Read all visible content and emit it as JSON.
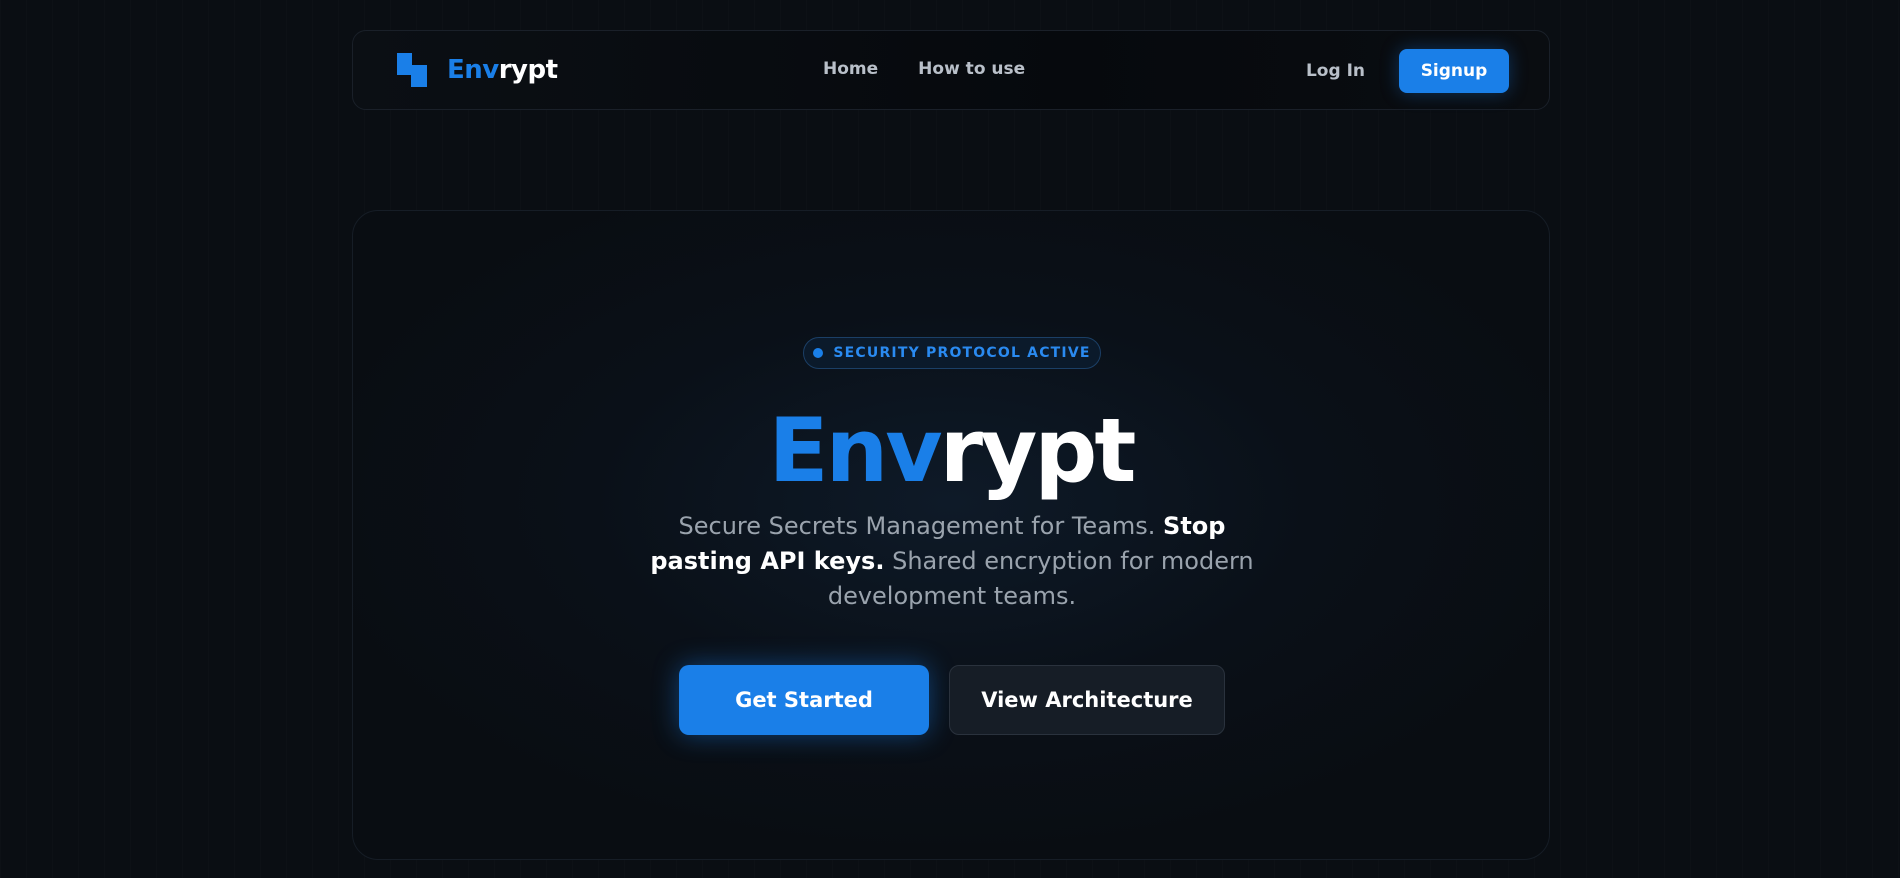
{
  "navbar": {
    "brand": {
      "part1": "Env",
      "part2": "rypt"
    },
    "links": [
      {
        "label": "Home"
      },
      {
        "label": "How to use"
      }
    ],
    "login_label": "Log In",
    "signup_label": "Signup"
  },
  "hero": {
    "badge": "SECURITY PROTOCOL ACTIVE",
    "title": {
      "part1": "Env",
      "part2": "rypt"
    },
    "subtitle": {
      "lead": "Secure Secrets Management for Teams.",
      "strong": "Stop pasting API keys.",
      "tail": "Shared encryption for modern development teams."
    },
    "primary_button": "Get Started",
    "secondary_button": "View Architecture"
  },
  "colors": {
    "accent": "#1a7fe8",
    "background": "#0a0e13"
  },
  "icons": {
    "logo": "envrypt-logo-icon",
    "badge_dot": "status-dot-icon"
  }
}
